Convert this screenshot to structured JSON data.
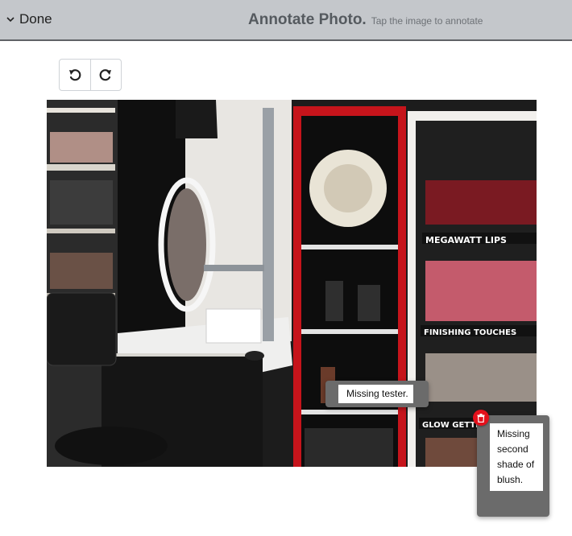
{
  "header": {
    "done_label": "Done",
    "title": "Annotate Photo.",
    "subtitle": "Tap the image to annotate"
  },
  "toolbar": {
    "undo_icon": "undo-icon",
    "redo_icon": "redo-icon"
  },
  "photo": {
    "signs": {
      "megawatt": "MEGAWATT LIPS",
      "finishing": "FINISHING TOUCHES",
      "glow": "GLOW GETTERS"
    }
  },
  "annotations": [
    {
      "text": "Missing tester."
    },
    {
      "text": "Missing second shade of blush."
    }
  ],
  "colors": {
    "header_bg": "#c4c7cb",
    "delete": "#e3101b"
  }
}
